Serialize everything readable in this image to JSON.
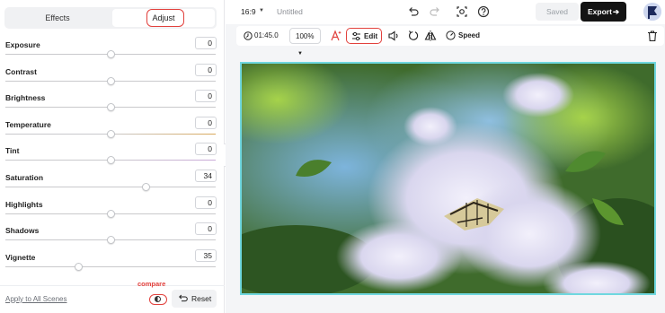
{
  "left_panel": {
    "tabs": [
      {
        "label": "Effects",
        "active": false
      },
      {
        "label": "Adjust",
        "active": true
      }
    ],
    "adjustments": [
      {
        "label": "Exposure",
        "value": "0",
        "level": 0.5
      },
      {
        "label": "Contrast",
        "value": "0",
        "level": 0.5
      },
      {
        "label": "Brightness",
        "value": "0",
        "level": 0.5
      },
      {
        "label": "Temperature",
        "value": "0",
        "level": 0.5
      },
      {
        "label": "Tint",
        "value": "0",
        "level": 0.5
      },
      {
        "label": "Saturation",
        "value": "34",
        "level": 0.67
      },
      {
        "label": "Highlights",
        "value": "0",
        "level": 0.5
      },
      {
        "label": "Shadows",
        "value": "0",
        "level": 0.5
      },
      {
        "label": "Vignette",
        "value": "35",
        "level": 0.35
      }
    ],
    "footer": {
      "apply_all": "Apply to All Scenes",
      "compare_label": "compare",
      "reset_label": "Reset"
    }
  },
  "topbar": {
    "aspect_ratio": "16:9",
    "project_title": "Untitled",
    "saved_label": "Saved",
    "export_label": "Export",
    "icons": [
      "undo-icon",
      "redo-icon",
      "capture-frame-icon",
      "help-icon",
      "avatar"
    ]
  },
  "toolbar": {
    "duration": "01:45.0",
    "zoom": "100%",
    "edit_label": "Edit",
    "speed_label": "Speed",
    "icons": [
      "clock-icon",
      "magic-text-icon",
      "sliders-icon",
      "volume-icon",
      "rotate-icon",
      "flip-icon",
      "speed-icon",
      "trash-icon"
    ]
  },
  "canvas": {
    "content": "photo",
    "selection_color": "#6fd7df"
  },
  "colors": {
    "accent_red": "#e2413d",
    "export_bg": "#141414",
    "canvas_bg": "#f4f5f7"
  }
}
